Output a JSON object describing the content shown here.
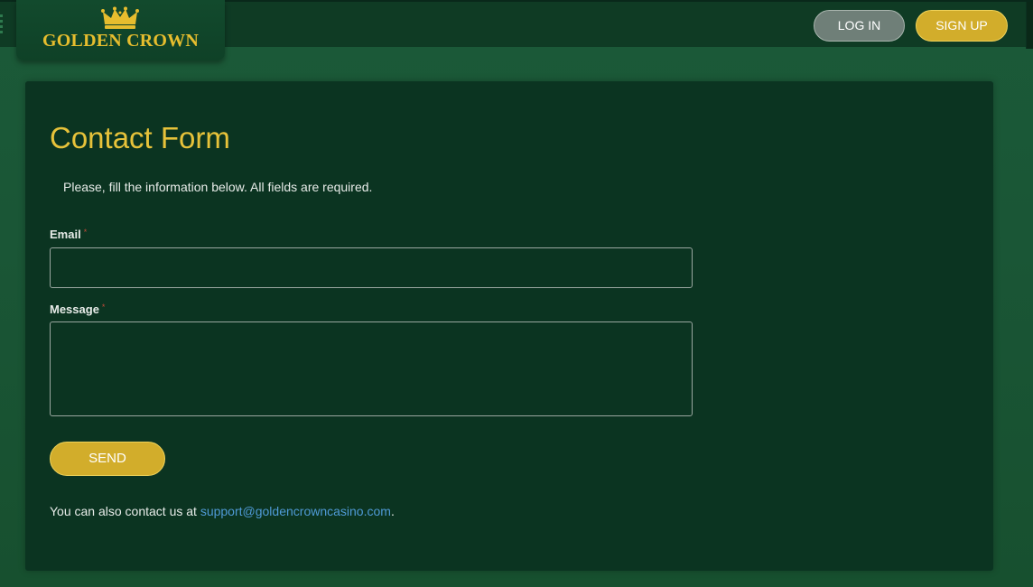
{
  "header": {
    "brand": "GOLDEN CROWN",
    "login_label": "LOG IN",
    "signup_label": "SIGN UP"
  },
  "colors": {
    "accent_gold": "#e6bd2e",
    "panel_bg": "#0b3421",
    "page_bg": "#1a5636",
    "link": "#4f9ad6"
  },
  "form": {
    "title": "Contact Form",
    "intro": "Please, fill the information below. All fields are required.",
    "required_marker": "*",
    "email_label": "Email",
    "email_value": "",
    "message_label": "Message",
    "message_value": "",
    "send_label": "SEND"
  },
  "footer": {
    "contact_prefix": "You can also contact us at ",
    "contact_email": "support@goldencrowncasino.com",
    "contact_suffix": "."
  }
}
